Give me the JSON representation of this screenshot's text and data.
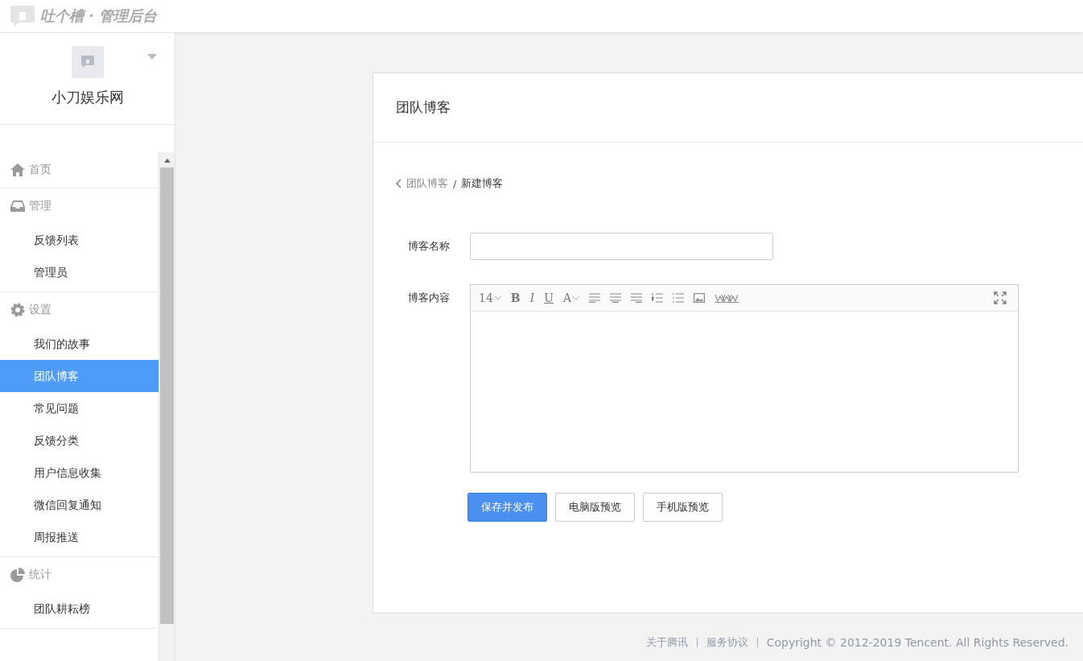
{
  "header": {
    "title": "吐个槽 · 管理后台"
  },
  "sidebar": {
    "site_name": "小刀娱乐网",
    "groups": [
      {
        "label": "首页",
        "kind": "home"
      },
      {
        "label": "管理",
        "kind": "inbox",
        "items": [
          {
            "label": "反馈列表",
            "selected": false
          },
          {
            "label": "管理员",
            "selected": false
          }
        ]
      },
      {
        "label": "设置",
        "kind": "gear",
        "items": [
          {
            "label": "我们的故事",
            "selected": false
          },
          {
            "label": "团队博客",
            "selected": true
          },
          {
            "label": "常见问题",
            "selected": false
          },
          {
            "label": "反馈分类",
            "selected": false
          },
          {
            "label": "用户信息收集",
            "selected": false
          },
          {
            "label": "微信回复通知",
            "selected": false
          },
          {
            "label": "周报推送",
            "selected": false
          }
        ]
      },
      {
        "label": "统计",
        "kind": "pie",
        "items": [
          {
            "label": "团队耕耘榜",
            "selected": false
          }
        ]
      }
    ]
  },
  "card": {
    "title": "团队博客",
    "breadcrumb": {
      "parent": "团队博客",
      "separator": "/",
      "current": "新建博客"
    },
    "form": {
      "name_label": "博客名称",
      "content_label": "博客内容",
      "toolbar": [
        {
          "kind": "size",
          "label": "14"
        },
        {
          "kind": "bold",
          "label": "B"
        },
        {
          "kind": "italic",
          "label": "I"
        },
        {
          "kind": "underline",
          "label": "U"
        },
        {
          "kind": "color",
          "label": "A"
        },
        {
          "kind": "align-left"
        },
        {
          "kind": "align-center"
        },
        {
          "kind": "align-right"
        },
        {
          "kind": "ordered-list"
        },
        {
          "kind": "bullet-list"
        },
        {
          "kind": "image"
        },
        {
          "kind": "link"
        }
      ],
      "buttons": [
        {
          "label": "保存并发布",
          "kind": "primary"
        },
        {
          "label": "电脑版预览",
          "kind": "default"
        },
        {
          "label": "手机版预览",
          "kind": "default"
        }
      ]
    }
  },
  "footer": {
    "links": [
      "关于腾讯",
      "服务协议"
    ],
    "copyright": "Copyright © 2012-2019 Tencent. All Rights Reserved."
  }
}
